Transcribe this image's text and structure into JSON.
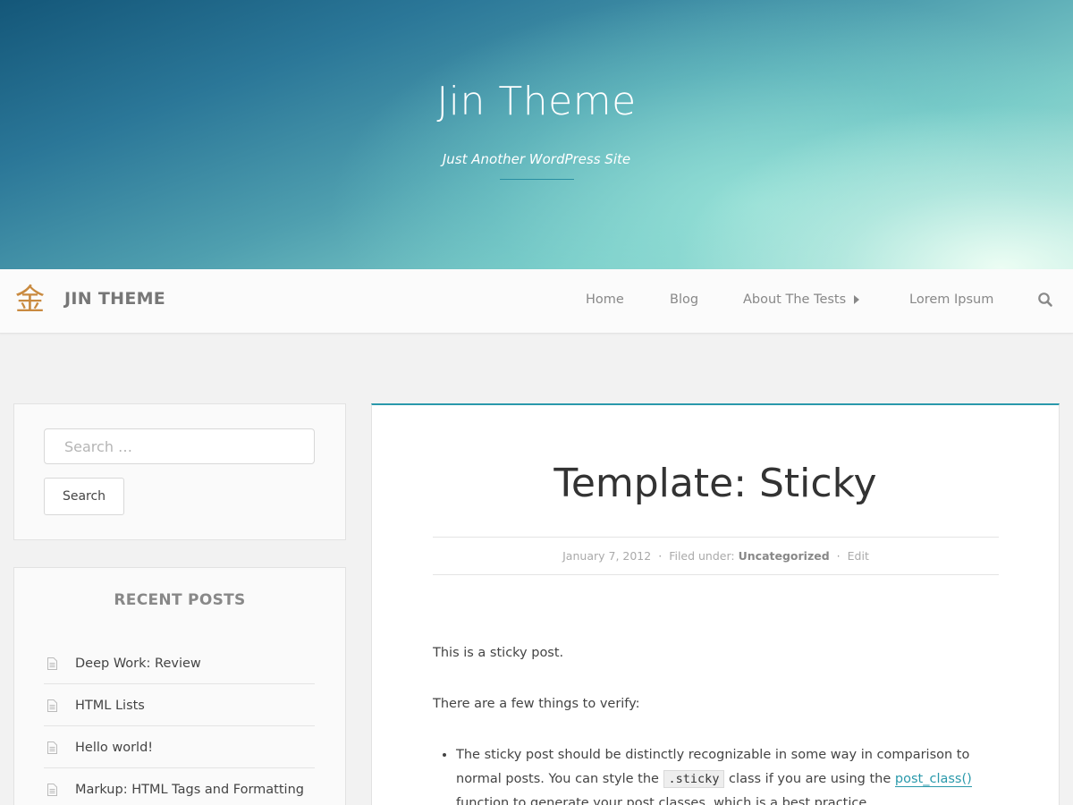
{
  "hero": {
    "title": "Jin Theme",
    "tagline": "Just Another WordPress Site"
  },
  "navbar": {
    "logo_glyph": "金",
    "brand": "JIN THEME",
    "items": [
      {
        "label": "Home"
      },
      {
        "label": "Blog"
      },
      {
        "label": "About The Tests",
        "has_submenu": true
      },
      {
        "label": "Lorem Ipsum"
      }
    ],
    "search_icon": "search-icon"
  },
  "sidebar": {
    "search_widget": {
      "placeholder": "Search …",
      "button_label": "Search"
    },
    "recent_posts": {
      "title": "RECENT POSTS",
      "items": [
        {
          "label": "Deep Work: Review",
          "icon": "document-icon"
        },
        {
          "label": "HTML Lists",
          "icon": "document-icon"
        },
        {
          "label": "Hello world!",
          "icon": "document-icon"
        },
        {
          "label": "Markup: HTML Tags and Formatting",
          "icon": "document-icon"
        }
      ]
    }
  },
  "post": {
    "title": "Template: Sticky",
    "meta": {
      "date": "January 7, 2012",
      "separator": "·",
      "filed_label": "Filed under:",
      "category": "Uncategorized",
      "edit": "Edit"
    },
    "paragraph1": "This is a sticky post.",
    "paragraph2": "There are a few things to verify:",
    "bullet1": {
      "text_before": "The sticky post should be distinctly recognizable in some way in comparison to normal posts. You can style the ",
      "code": ".sticky",
      "text_middle": " class if you are using the ",
      "link": "post_class()",
      "text_after": " function to generate your post classes, which is a best practice."
    }
  },
  "colors": {
    "accent": "#2a99ab",
    "logo": "#c98a3f",
    "background": "#f2f2f2"
  }
}
